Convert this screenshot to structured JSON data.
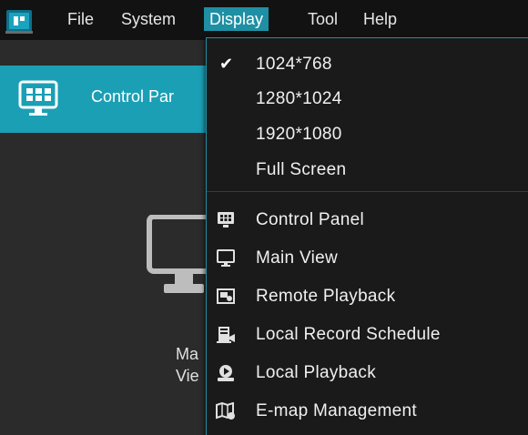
{
  "menubar": {
    "items": [
      "File",
      "System",
      "Display",
      "Tool",
      "Help"
    ],
    "active": "Display"
  },
  "control_panel": {
    "label": "Control Par"
  },
  "main": {
    "label_line1": "Ma",
    "label_line2": "Vie"
  },
  "display_menu": {
    "resolutions": [
      "1024*768",
      "1280*1024",
      "1920*1080",
      "Full Screen"
    ],
    "checked": "1024*768",
    "views": [
      "Control Panel",
      "Main View",
      "Remote Playback",
      "Local Record Schedule",
      "Local Playback",
      "E-map Management"
    ]
  },
  "icons": {
    "check": "checkmark-icon",
    "control_panel": "control-panel-icon",
    "main_view": "monitor-icon",
    "remote_playback": "remote-playback-icon",
    "local_record_schedule": "record-schedule-icon",
    "local_playback": "local-playback-icon",
    "emap": "emap-icon"
  },
  "colors": {
    "accent": "#1f8fa3",
    "strip": "#1b9fb5",
    "menubar": "#121212",
    "dropdown": "#1a1a1a"
  }
}
